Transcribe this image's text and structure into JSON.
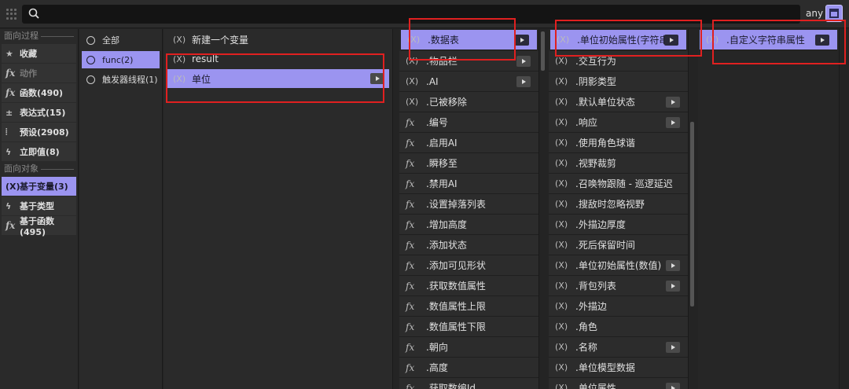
{
  "search": {
    "placeholder": "",
    "filter_label": "any"
  },
  "colors": {
    "accent": "#9b94f0",
    "highlight_box": "#e02020"
  },
  "left_panel": {
    "section1": "面向过程",
    "items1": [
      {
        "icon": "star-icon",
        "label": "收藏"
      },
      {
        "icon": "fx-icon",
        "label": "动作"
      },
      {
        "icon": "fx-icon",
        "label": "函数(490)"
      },
      {
        "icon": "expression-icon",
        "label": "表达式(15)"
      },
      {
        "icon": "preset-icon",
        "label": "预设(2908)"
      },
      {
        "icon": "lightning-icon",
        "label": "立即值(8)"
      }
    ],
    "section2": "面向对象",
    "items2": [
      {
        "icon": "variable-icon",
        "label": "基于变量(3)"
      },
      {
        "icon": "lightning-icon",
        "label": "基于类型"
      },
      {
        "icon": "fx-icon",
        "label": "基于函数(495)"
      }
    ]
  },
  "scope_panel": {
    "items": [
      "全部",
      "func(2)",
      "触发器线程(1)"
    ]
  },
  "variable_panel": {
    "items": [
      "新建一个变量",
      "result",
      "单位"
    ]
  },
  "col4": {
    "items": [
      {
        "t": "v",
        "label": ".数据表",
        "arrow": true
      },
      {
        "t": "v",
        "label": ".物品栏",
        "arrow": true
      },
      {
        "t": "v",
        "label": ".AI",
        "arrow": true
      },
      {
        "t": "v",
        "label": ".已被移除"
      },
      {
        "t": "f",
        "label": ".编号"
      },
      {
        "t": "f",
        "label": ".启用AI"
      },
      {
        "t": "f",
        "label": ".瞬移至"
      },
      {
        "t": "f",
        "label": ".禁用AI"
      },
      {
        "t": "f",
        "label": ".设置掉落列表"
      },
      {
        "t": "f",
        "label": ".增加高度"
      },
      {
        "t": "f",
        "label": ".添加状态"
      },
      {
        "t": "f",
        "label": ".添加可见形状"
      },
      {
        "t": "f",
        "label": ".获取数值属性"
      },
      {
        "t": "f",
        "label": ".数值属性上限"
      },
      {
        "t": "f",
        "label": ".数值属性下限"
      },
      {
        "t": "f",
        "label": ".朝向"
      },
      {
        "t": "f",
        "label": ".高度"
      },
      {
        "t": "f",
        "label": ".获取数编Id"
      }
    ]
  },
  "col5": {
    "items": [
      {
        "label": ".单位初始属性(字符串)",
        "arrow": true
      },
      {
        "label": ".交互行为"
      },
      {
        "label": ".阴影类型"
      },
      {
        "label": ".默认单位状态",
        "arrow": true
      },
      {
        "label": ".响应",
        "arrow": true
      },
      {
        "label": ".使用角色球谐"
      },
      {
        "label": ".视野裁剪"
      },
      {
        "label": ".召唤物跟随 - 巡逻延迟"
      },
      {
        "label": ".搜敌时忽略视野"
      },
      {
        "label": ".外描边厚度"
      },
      {
        "label": ".死后保留时间"
      },
      {
        "label": ".单位初始属性(数值)",
        "arrow": true
      },
      {
        "label": ".背包列表",
        "arrow": true
      },
      {
        "label": ".外描边"
      },
      {
        "label": ".角色"
      },
      {
        "label": ".名称",
        "arrow": true
      },
      {
        "label": ".单位模型数据"
      },
      {
        "label": ".单位属性",
        "arrow": true
      }
    ]
  },
  "col6": {
    "items": [
      {
        "label": ".自定义字符串属性",
        "arrow": true
      }
    ]
  }
}
